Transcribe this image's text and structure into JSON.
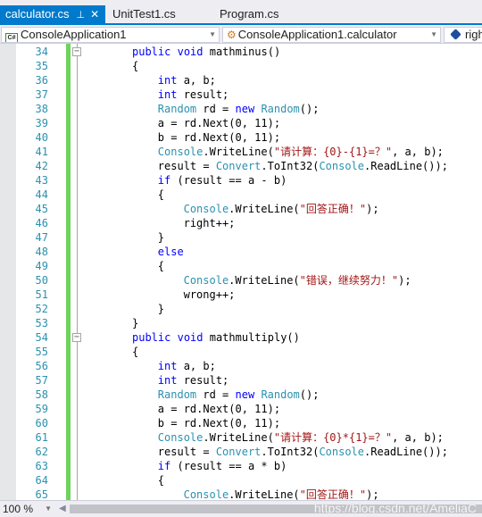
{
  "tabs": [
    {
      "label": "calculator.cs",
      "active": true,
      "pin": "⊥",
      "close": "✕"
    },
    {
      "label": "UnitTest1.cs",
      "active": false
    },
    {
      "label": "Program.cs",
      "active": false
    }
  ],
  "navbar": {
    "project": {
      "icon": "C#",
      "label": "ConsoleApplication1"
    },
    "type": {
      "label": "ConsoleApplication1.calculator"
    },
    "member": {
      "label": "righ"
    },
    "dropdown_arrow": "▼"
  },
  "editor": {
    "lines": [
      {
        "n": "34",
        "fold": "−",
        "indent": 2,
        "tokens": [
          [
            "kw",
            "public"
          ],
          [
            "",
            ""
          ],
          [
            "",
            ""
          ]
        ]
      },
      {
        "n": "35"
      },
      {
        "n": "36"
      },
      {
        "n": "37"
      },
      {
        "n": "38"
      },
      {
        "n": "39"
      },
      {
        "n": "40"
      },
      {
        "n": "41"
      },
      {
        "n": "42"
      },
      {
        "n": "43"
      },
      {
        "n": "44"
      },
      {
        "n": "45"
      },
      {
        "n": "46"
      },
      {
        "n": "47"
      },
      {
        "n": "48"
      },
      {
        "n": "49"
      },
      {
        "n": "50"
      },
      {
        "n": "51"
      },
      {
        "n": "52"
      },
      {
        "n": "53"
      },
      {
        "n": "54"
      },
      {
        "n": "55"
      },
      {
        "n": "56"
      },
      {
        "n": "57"
      },
      {
        "n": "58"
      },
      {
        "n": "59"
      },
      {
        "n": "60"
      },
      {
        "n": "61"
      },
      {
        "n": "62"
      },
      {
        "n": "63"
      },
      {
        "n": "64"
      },
      {
        "n": "65"
      }
    ],
    "code": [
      {
        "n": "34",
        "fold": true,
        "indent": 8,
        "t": [
          [
            "kw",
            "public"
          ],
          [
            "",
            " "
          ],
          [
            "kw",
            "void"
          ],
          [
            "",
            " mathminus()"
          ]
        ]
      },
      {
        "n": "35",
        "indent": 8,
        "t": [
          [
            "",
            "{"
          ]
        ]
      },
      {
        "n": "36",
        "indent": 12,
        "t": [
          [
            "kw",
            "int"
          ],
          [
            "",
            " a, b;"
          ]
        ]
      },
      {
        "n": "37",
        "indent": 12,
        "t": [
          [
            "kw",
            "int"
          ],
          [
            "",
            " result;"
          ]
        ]
      },
      {
        "n": "38",
        "indent": 12,
        "t": [
          [
            "ty",
            "Random"
          ],
          [
            "",
            " rd = "
          ],
          [
            "kw",
            "new"
          ],
          [
            "",
            " "
          ],
          [
            "ty",
            "Random"
          ],
          [
            "",
            "();"
          ]
        ]
      },
      {
        "n": "39",
        "indent": 12,
        "t": [
          [
            "",
            "a = rd.Next(0, 11);"
          ]
        ]
      },
      {
        "n": "40",
        "indent": 12,
        "t": [
          [
            "",
            "b = rd.Next(0, 11);"
          ]
        ]
      },
      {
        "n": "41",
        "indent": 12,
        "t": [
          [
            "ty",
            "Console"
          ],
          [
            "",
            ".WriteLine("
          ],
          [
            "str",
            "\"请计算：{0}-{1}=？\""
          ],
          [
            "",
            ", a, b);"
          ]
        ]
      },
      {
        "n": "42",
        "indent": 12,
        "t": [
          [
            "",
            "result = "
          ],
          [
            "ty",
            "Convert"
          ],
          [
            "",
            ".ToInt32("
          ],
          [
            "ty",
            "Console"
          ],
          [
            "",
            ".ReadLine());"
          ]
        ]
      },
      {
        "n": "43",
        "indent": 12,
        "t": [
          [
            "kw",
            "if"
          ],
          [
            "",
            " (result == a - b)"
          ]
        ]
      },
      {
        "n": "44",
        "indent": 12,
        "t": [
          [
            "",
            "{"
          ]
        ]
      },
      {
        "n": "45",
        "indent": 16,
        "t": [
          [
            "ty",
            "Console"
          ],
          [
            "",
            ".WriteLine("
          ],
          [
            "str",
            "\"回答正确！\""
          ],
          [
            "",
            ");"
          ]
        ]
      },
      {
        "n": "46",
        "indent": 16,
        "t": [
          [
            "",
            "right++;"
          ]
        ]
      },
      {
        "n": "47",
        "indent": 12,
        "t": [
          [
            "",
            "}"
          ]
        ]
      },
      {
        "n": "48",
        "indent": 12,
        "t": [
          [
            "kw",
            "else"
          ]
        ]
      },
      {
        "n": "49",
        "indent": 12,
        "t": [
          [
            "",
            "{"
          ]
        ]
      },
      {
        "n": "50",
        "indent": 16,
        "t": [
          [
            "ty",
            "Console"
          ],
          [
            "",
            ".WriteLine("
          ],
          [
            "str",
            "\"错误，继续努力！\""
          ],
          [
            "",
            ");"
          ]
        ]
      },
      {
        "n": "51",
        "indent": 16,
        "t": [
          [
            "",
            "wrong++;"
          ]
        ]
      },
      {
        "n": "52",
        "indent": 12,
        "t": [
          [
            "",
            "}"
          ]
        ]
      },
      {
        "n": "53",
        "indent": 8,
        "t": [
          [
            "",
            "}"
          ]
        ]
      },
      {
        "n": "54",
        "fold": true,
        "indent": 8,
        "t": [
          [
            "kw",
            "public"
          ],
          [
            "",
            " "
          ],
          [
            "kw",
            "void"
          ],
          [
            "",
            " mathmultiply()"
          ]
        ]
      },
      {
        "n": "55",
        "indent": 8,
        "t": [
          [
            "",
            "{"
          ]
        ]
      },
      {
        "n": "56",
        "indent": 12,
        "t": [
          [
            "kw",
            "int"
          ],
          [
            "",
            " a, b;"
          ]
        ]
      },
      {
        "n": "57",
        "indent": 12,
        "t": [
          [
            "kw",
            "int"
          ],
          [
            "",
            " result;"
          ]
        ]
      },
      {
        "n": "58",
        "indent": 12,
        "t": [
          [
            "ty",
            "Random"
          ],
          [
            "",
            " rd = "
          ],
          [
            "kw",
            "new"
          ],
          [
            "",
            " "
          ],
          [
            "ty",
            "Random"
          ],
          [
            "",
            "();"
          ]
        ]
      },
      {
        "n": "59",
        "indent": 12,
        "t": [
          [
            "",
            "a = rd.Next(0, 11);"
          ]
        ]
      },
      {
        "n": "60",
        "indent": 12,
        "t": [
          [
            "",
            "b = rd.Next(0, 11);"
          ]
        ]
      },
      {
        "n": "61",
        "indent": 12,
        "t": [
          [
            "ty",
            "Console"
          ],
          [
            "",
            ".WriteLine("
          ],
          [
            "str",
            "\"请计算：{0}*{1}=？\""
          ],
          [
            "",
            ", a, b);"
          ]
        ]
      },
      {
        "n": "62",
        "indent": 12,
        "t": [
          [
            "",
            "result = "
          ],
          [
            "ty",
            "Convert"
          ],
          [
            "",
            ".ToInt32("
          ],
          [
            "ty",
            "Console"
          ],
          [
            "",
            ".ReadLine());"
          ]
        ]
      },
      {
        "n": "63",
        "indent": 12,
        "t": [
          [
            "kw",
            "if"
          ],
          [
            "",
            " (result == a * b)"
          ]
        ]
      },
      {
        "n": "64",
        "indent": 12,
        "t": [
          [
            "",
            "{"
          ]
        ]
      },
      {
        "n": "65",
        "indent": 16,
        "t": [
          [
            "ty",
            "Console"
          ],
          [
            "",
            ".WriteLine("
          ],
          [
            "str",
            "\"回答正确！\""
          ],
          [
            "",
            ");"
          ]
        ]
      }
    ]
  },
  "statusbar": {
    "zoom": "100 %",
    "zoom_arrow": "▼",
    "scroll_left": "◀",
    "watermark": "https://blog.csdn.net/AmeliaC"
  }
}
